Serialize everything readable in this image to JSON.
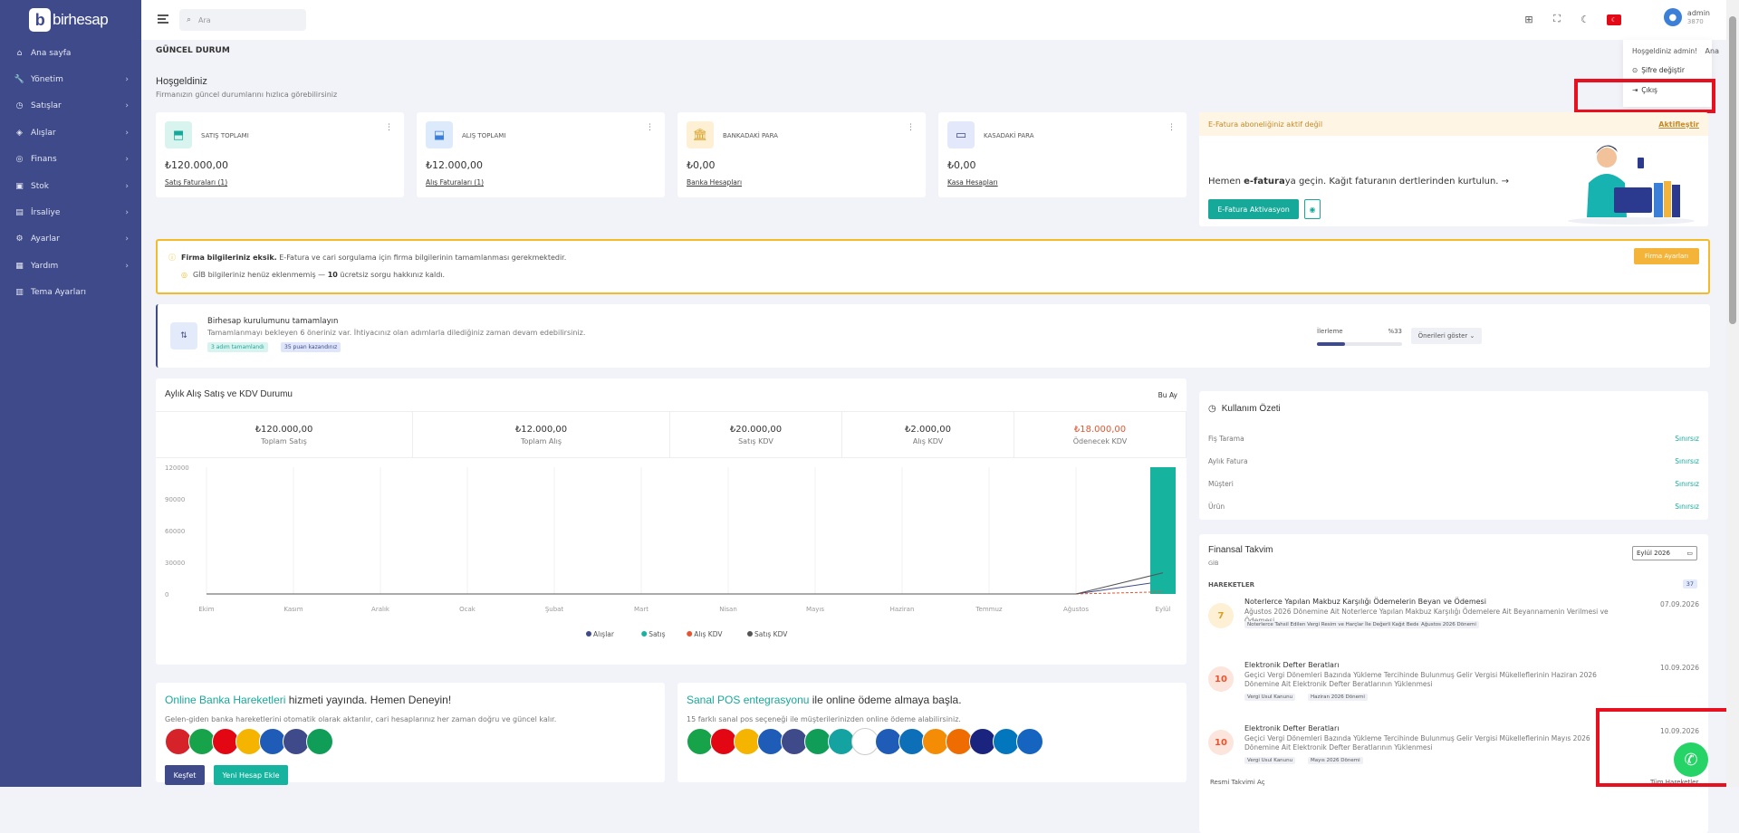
{
  "brand": {
    "name": "birhesap"
  },
  "sidebar": {
    "items": [
      {
        "label": "Ana sayfa",
        "icon": "home-icon",
        "glyph": "⌂",
        "chevron": false
      },
      {
        "label": "Yönetim",
        "icon": "wrench-icon",
        "glyph": "🔧",
        "chevron": true
      },
      {
        "label": "Satışlar",
        "icon": "sales-icon",
        "glyph": "◷",
        "chevron": true
      },
      {
        "label": "Alışlar",
        "icon": "purchases-icon",
        "glyph": "◈",
        "chevron": true
      },
      {
        "label": "Finans",
        "icon": "finance-icon",
        "glyph": "◎",
        "chevron": true
      },
      {
        "label": "Stok",
        "icon": "stock-icon",
        "glyph": "▣",
        "chevron": true
      },
      {
        "label": "İrsaliye",
        "icon": "waybill-icon",
        "glyph": "▤",
        "chevron": true
      },
      {
        "label": "Ayarlar",
        "icon": "settings-icon",
        "glyph": "⚙",
        "chevron": true
      },
      {
        "label": "Yardım",
        "icon": "help-icon",
        "glyph": "▦",
        "chevron": true
      },
      {
        "label": "Tema Ayarları",
        "icon": "theme-icon",
        "glyph": "▥",
        "chevron": false
      }
    ]
  },
  "search": {
    "placeholder": "Ara"
  },
  "user": {
    "name": "admin",
    "id": "3870"
  },
  "dropdown": {
    "greeting": "Hoşgeldiniz admin!",
    "change_password": "Şifre değiştir",
    "logout": "Çıkış"
  },
  "page": {
    "title": "GÜNCEL DURUM",
    "breadcrumb": "Ana"
  },
  "welcome": {
    "title": "Hoşgeldiniz",
    "subtitle": "Firmanızın güncel durumlarını hızlıca görebilirsiniz"
  },
  "cards": [
    {
      "title": "SATIŞ TOPLAMI",
      "value": "₺120.000,00",
      "link": "Satış Faturaları (1)",
      "color": "#d9f3ef",
      "fg": "#16a99a",
      "glyph": "⬒"
    },
    {
      "title": "ALIŞ TOPLAMI",
      "value": "₺12.000,00",
      "link": "Alış Faturaları (1)",
      "color": "#ddeafb",
      "fg": "#3b7fd8",
      "glyph": "⬓"
    },
    {
      "title": "BANKADAKİ PARA",
      "value": "₺0,00",
      "link": "Banka Hesapları",
      "color": "#fdf0d4",
      "fg": "#d9a024",
      "glyph": "🏛"
    },
    {
      "title": "KASADAKİ PARA",
      "value": "₺0,00",
      "link": "Kasa Hesapları",
      "color": "#e3e8fb",
      "fg": "#3e4a8a",
      "glyph": "▭"
    }
  ],
  "efatura": {
    "header": "E-Fatura aboneliğiniz aktif değil",
    "activate_link": "Aktifleştir",
    "msg_pre": "Hemen ",
    "msg_bold": "e-fatura",
    "msg_post": "ya geçin. Kağıt faturanın dertlerinden kurtulun. →",
    "button": "E-Fatura Aktivasyon"
  },
  "warning": {
    "bold": "Firma bilgileriniz eksik.",
    "text": "E-Fatura ve cari sorgulama için firma bilgilerinin tamamlanması gerekmektedir.",
    "gib_pre": "GİB bilgileriniz henüz eklenmemiş — ",
    "gib_count": "10",
    "gib_post": " ücretsiz sorgu hakkınız kaldı.",
    "button": "Firma Ayarları"
  },
  "setup": {
    "title": "Birhesap kurulumunu tamamlayın",
    "text": "Tamamlanmayı bekleyen 6 öneriniz var. İhtiyacınız olan adımlarla dilediğiniz zaman devam edebilirsiniz.",
    "tag1": "3 adım tamamlandı",
    "tag2": "35 puan kazandınız",
    "progress_label": "İlerleme",
    "progress_pct": "%33",
    "progress_value": 0.33,
    "button": "Önerileri göster"
  },
  "chart_section": {
    "title": "Aylık Alış Satış ve KDV Durumu",
    "period": "Bu Ay",
    "stats": [
      {
        "value": "₺120.000,00",
        "label": "Toplam Satış",
        "color": "#333"
      },
      {
        "value": "₺12.000,00",
        "label": "Toplam Alış",
        "color": "#333"
      },
      {
        "value": "₺20.000,00",
        "label": "Satış KDV",
        "color": "#333"
      },
      {
        "value": "₺2.000,00",
        "label": "Alış KDV",
        "color": "#333"
      },
      {
        "value": "₺18.000,00",
        "label": "Ödenecek KDV",
        "color": "#e8542f"
      }
    ]
  },
  "chart_data": {
    "type": "bar",
    "categories": [
      "Ekim",
      "Kasım",
      "Aralık",
      "Ocak",
      "Şubat",
      "Mart",
      "Nisan",
      "Mayıs",
      "Haziran",
      "Temmuz",
      "Ağustos",
      "Eylül"
    ],
    "series": [
      {
        "name": "Alışlar",
        "color": "#3e4a8a",
        "kind": "line",
        "values": [
          0,
          0,
          0,
          0,
          0,
          0,
          0,
          0,
          0,
          0,
          0,
          12000
        ]
      },
      {
        "name": "Satış",
        "color": "#16b39e",
        "kind": "bar",
        "values": [
          0,
          0,
          0,
          0,
          0,
          0,
          0,
          0,
          0,
          0,
          0,
          120000
        ]
      },
      {
        "name": "Alış KDV",
        "color": "#e8542f",
        "kind": "line",
        "values": [
          0,
          0,
          0,
          0,
          0,
          0,
          0,
          0,
          0,
          0,
          0,
          2000
        ]
      },
      {
        "name": "Satış KDV",
        "color": "#555555",
        "kind": "line",
        "values": [
          0,
          0,
          0,
          0,
          0,
          0,
          0,
          0,
          0,
          0,
          0,
          20000
        ]
      }
    ],
    "yticks": [
      "120000",
      "90000",
      "60000",
      "30000",
      "0"
    ],
    "ylim": [
      0,
      120000
    ],
    "legend": "bottom"
  },
  "ozet": {
    "title": "Kullanım Özeti",
    "rows": [
      {
        "label": "Fiş Tarama",
        "value": "Sınırsız"
      },
      {
        "label": "Aylık Fatura",
        "value": "Sınırsız"
      },
      {
        "label": "Müşteri",
        "value": "Sınırsız"
      },
      {
        "label": "Ürün",
        "value": "Sınırsız"
      }
    ]
  },
  "takvim": {
    "title": "Finansal Takvim",
    "sub": "GİB",
    "month": "Eylül 2026",
    "header": "HAREKETLER",
    "count": "37",
    "events": [
      {
        "badge": "7",
        "title": "Noterlerce Yapılan Makbuz Karşılığı Ödemelerin Beyan ve Ödemesi",
        "desc": "Ağustos 2026 Dönemine Ait Noterlerce Yapılan Makbuz Karşılığı Ödemelere Ait Beyannamenin Verilmesi ve Ödemesi",
        "date": "07.09.2026",
        "tag1": "Noterlerce Tahsil Edilen Vergi Resim ve Harçlar İle Değerli Kağıt Bedelleri",
        "tag2": "Ağustos 2026 Dönemi"
      },
      {
        "badge": "10",
        "title": "Elektronik Defter Beratları",
        "desc": "Geçici Vergi Dönemleri Bazında Yükleme Tercihinde Bulunmuş Gelir Vergisi Mükelleflerinin Haziran 2026 Dönemine Ait Elektronik Defter Beratlarının Yüklenmesi",
        "date": "10.09.2026",
        "tag1": "Vergi Usul Kanunu",
        "tag2": "Haziran 2026 Dönemi"
      },
      {
        "badge": "10",
        "title": "Elektronik Defter Beratları",
        "desc": "Geçici Vergi Dönemleri Bazında Yükleme Tercihinde Bulunmuş Gelir Vergisi Mükelleflerinin Mayıs 2026 Dönemine Ait Elektronik Defter Beratlarının Yüklenmesi",
        "date": "10.09.2026",
        "tag1": "Vergi Usul Kanunu",
        "tag2": "Mayıs 2026 Dönemi"
      }
    ],
    "footer_left": "Resmi Takvimi Aç",
    "footer_right": "Tüm Hareketler"
  },
  "promo_bank": {
    "title_hl": "Online Banka Hareketleri",
    "title_rest": " hizmeti yayında. Hemen Deneyin!",
    "text": "Gelen-giden banka hareketlerini otomatik olarak aktarılır, cari hesaplarınız her zaman doğru ve güncel kalır.",
    "btn1": "Keşfet",
    "btn2": "Yeni Hesap Ekle"
  },
  "promo_pos": {
    "title_hl": "Sanal POS entegrasyonu",
    "title_rest": " ile online ödeme almaya başla.",
    "text": "15 farklı sanal pos seçeneği ile müşterilerinizden online ödeme alabilirsiniz."
  }
}
